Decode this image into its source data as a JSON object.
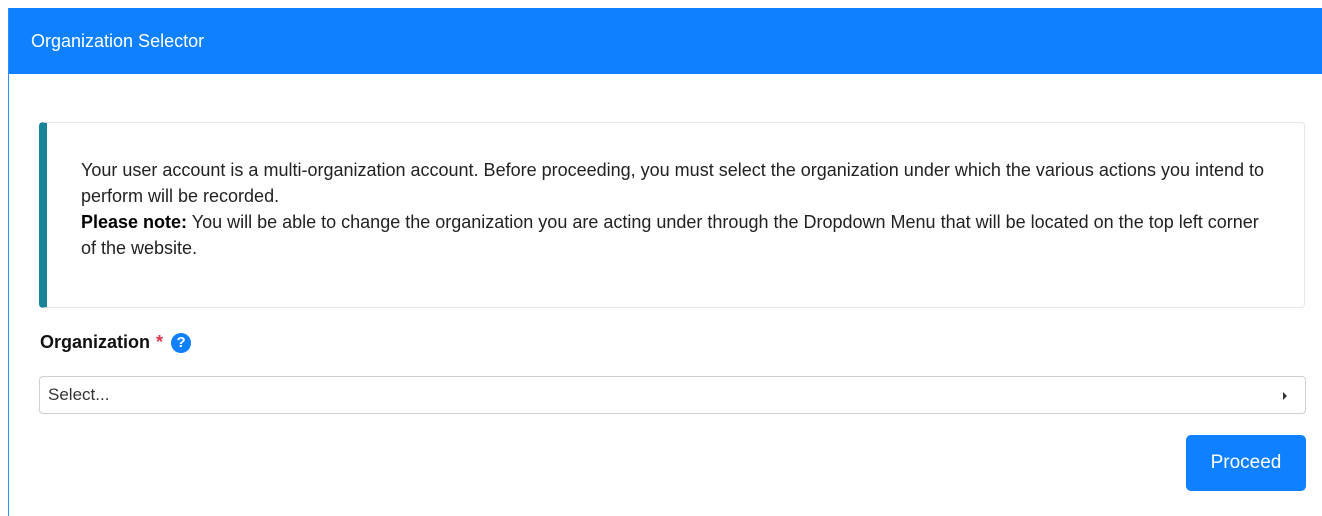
{
  "header": {
    "title": "Organization Selector"
  },
  "info": {
    "paragraph": "Your user account is a multi-organization account. Before proceeding, you must select the organization under which the various actions you intend to perform will be recorded.",
    "note_label": "Please note:",
    "note_text": " You will be able to change the organization you are acting under through the Dropdown Menu that will be located on the top left corner of the website."
  },
  "form": {
    "organization_label": "Organization",
    "required_marker": "*",
    "help_icon": "?",
    "select_value": "Select...",
    "submit_label": "Proceed"
  },
  "colors": {
    "header_bg": "#0f80ff",
    "info_accent": "#17849a",
    "required": "#dc3545",
    "button_bg": "#0f80ff"
  },
  "icons": {
    "help": "question-circle-icon",
    "select_arrow": "caret-right-icon"
  }
}
